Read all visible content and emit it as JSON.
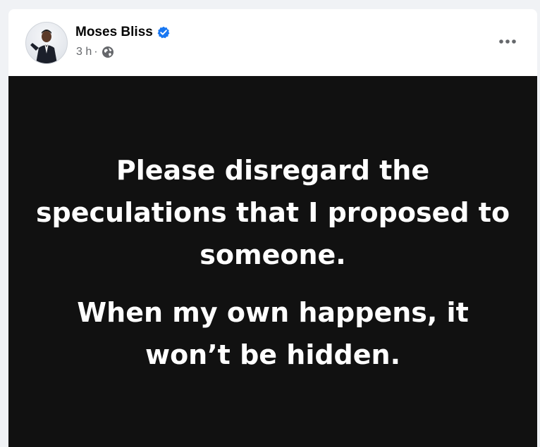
{
  "post": {
    "author": "Moses Bliss",
    "verified_icon": "verified-badge-icon",
    "time": "3 h",
    "separator": "·",
    "audience_icon": "globe-icon",
    "more_icon": "more-options-icon",
    "image_text": {
      "line1": "Please disregard the",
      "line2": "speculations that I proposed to",
      "line3": "someone.",
      "line4": "When my own happens, it",
      "line5": "won’t be hidden."
    }
  },
  "colors": {
    "verified": "#1877f2",
    "meta_text": "#65676b",
    "image_background": "#111111",
    "page_background": "#f0f2f5"
  }
}
